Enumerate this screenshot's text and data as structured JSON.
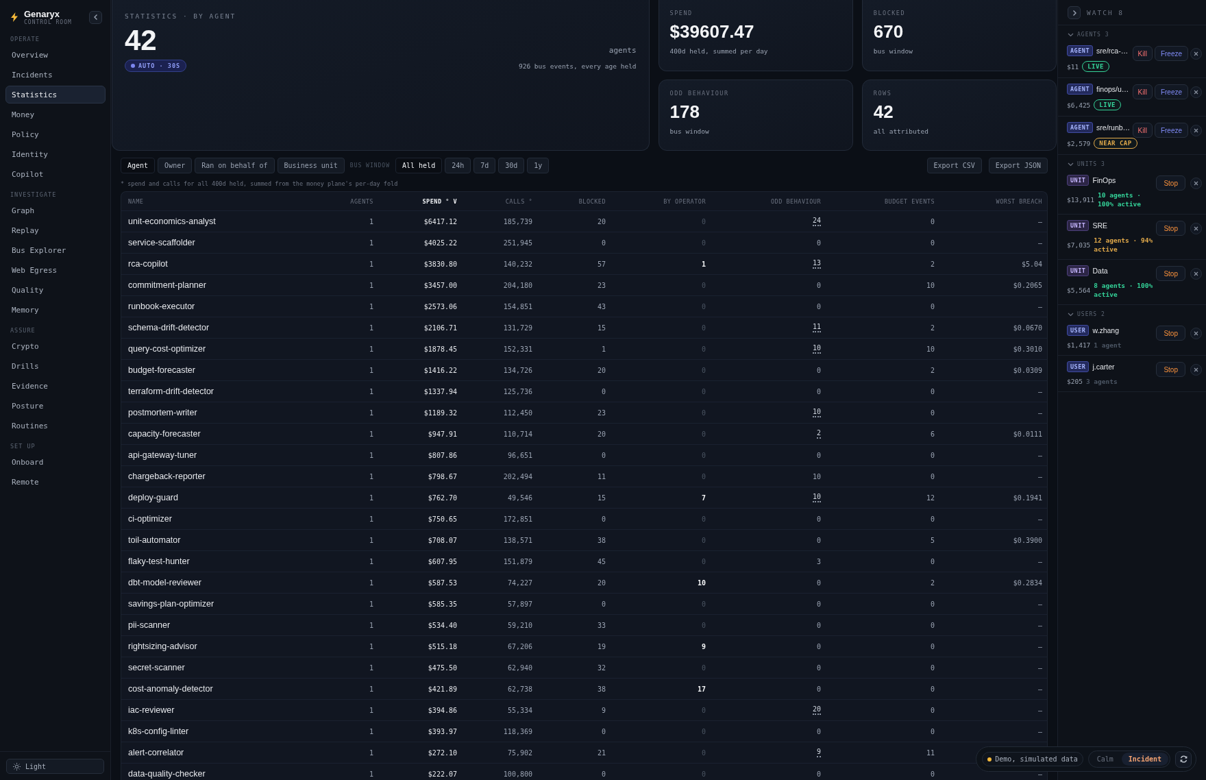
{
  "brand": {
    "name": "Genaryx",
    "subtitle": "CONTROL ROOM"
  },
  "sidebar": {
    "sections": [
      {
        "title": "OPERATE",
        "items": [
          {
            "label": "Overview",
            "selected": false
          },
          {
            "label": "Incidents",
            "selected": false
          },
          {
            "label": "Statistics",
            "selected": true
          },
          {
            "label": "Money",
            "selected": false
          },
          {
            "label": "Policy",
            "selected": false
          },
          {
            "label": "Identity",
            "selected": false
          },
          {
            "label": "Copilot",
            "selected": false
          }
        ]
      },
      {
        "title": "INVESTIGATE",
        "items": [
          {
            "label": "Graph",
            "selected": false
          },
          {
            "label": "Replay",
            "selected": false
          },
          {
            "label": "Bus Explorer",
            "selected": false
          },
          {
            "label": "Web Egress",
            "selected": false
          },
          {
            "label": "Quality",
            "selected": false
          },
          {
            "label": "Memory",
            "selected": false
          }
        ]
      },
      {
        "title": "ASSURE",
        "items": [
          {
            "label": "Crypto",
            "selected": false
          },
          {
            "label": "Drills",
            "selected": false
          },
          {
            "label": "Evidence",
            "selected": false
          },
          {
            "label": "Posture",
            "selected": false
          },
          {
            "label": "Routines",
            "selected": false
          }
        ]
      },
      {
        "title": "SET UP",
        "items": [
          {
            "label": "Onboard",
            "selected": false
          },
          {
            "label": "Remote",
            "selected": false
          }
        ]
      }
    ],
    "theme_button": "Light"
  },
  "hero": {
    "title": "STATISTICS · BY AGENT",
    "value": "42",
    "unit": "agents",
    "badge": "AUTO · 30S",
    "note": "926 bus events, every age held"
  },
  "stats": [
    {
      "label": "SPEND",
      "value": "$39607.47",
      "note": "400d held, summed per day"
    },
    {
      "label": "BLOCKED",
      "value": "670",
      "note": "bus window"
    },
    {
      "label": "ODD BEHAVIOUR",
      "value": "178",
      "note": "bus window"
    },
    {
      "label": "ROWS",
      "value": "42",
      "note": "all attributed"
    }
  ],
  "filters": {
    "group_by": [
      {
        "label": "Agent",
        "selected": true
      },
      {
        "label": "Owner",
        "selected": false
      },
      {
        "label": "Ran on behalf of",
        "selected": false
      },
      {
        "label": "Business unit",
        "selected": false
      }
    ],
    "window_label": "BUS WINDOW",
    "windows": [
      {
        "label": "All held",
        "selected": true
      },
      {
        "label": "24h",
        "selected": false
      },
      {
        "label": "7d",
        "selected": false
      },
      {
        "label": "30d",
        "selected": false
      },
      {
        "label": "1y",
        "selected": false
      }
    ],
    "exports": [
      "Export CSV",
      "Export JSON"
    ]
  },
  "footnote": "* spend and calls for all 400d held, summed from the money plane's per-day fold",
  "table": {
    "columns": [
      {
        "label": "NAME",
        "sorted": false
      },
      {
        "label": "AGENTS",
        "sorted": false
      },
      {
        "label": "SPEND ° V",
        "sorted": true
      },
      {
        "label": "CALLS °",
        "sorted": false
      },
      {
        "label": "BLOCKED",
        "sorted": false
      },
      {
        "label": "BY OPERATOR",
        "sorted": false
      },
      {
        "label": "ODD BEHAVIOUR",
        "sorted": false
      },
      {
        "label": "BUDGET EVENTS",
        "sorted": false
      },
      {
        "label": "WORST BREACH",
        "sorted": false
      }
    ],
    "rows": [
      {
        "name": "unit-economics-analyst",
        "agents": "1",
        "spend": "$6417.12",
        "calls": "185,739",
        "blocked": "20",
        "by_operator": "0",
        "operator_marked": false,
        "odd_behaviour": "24",
        "odd_flagged": true,
        "budget_events": "0",
        "worst_breach": "–"
      },
      {
        "name": "service-scaffolder",
        "agents": "1",
        "spend": "$4025.22",
        "calls": "251,945",
        "blocked": "0",
        "by_operator": "0",
        "operator_marked": false,
        "odd_behaviour": "0",
        "odd_flagged": false,
        "budget_events": "0",
        "worst_breach": "–"
      },
      {
        "name": "rca-copilot",
        "agents": "1",
        "spend": "$3830.80",
        "calls": "140,232",
        "blocked": "57",
        "by_operator": "1",
        "operator_marked": true,
        "odd_behaviour": "13",
        "odd_flagged": true,
        "budget_events": "2",
        "worst_breach": "$5.04"
      },
      {
        "name": "commitment-planner",
        "agents": "1",
        "spend": "$3457.00",
        "calls": "204,180",
        "blocked": "23",
        "by_operator": "0",
        "operator_marked": false,
        "odd_behaviour": "0",
        "odd_flagged": false,
        "budget_events": "10",
        "worst_breach": "$0.2065"
      },
      {
        "name": "runbook-executor",
        "agents": "1",
        "spend": "$2573.06",
        "calls": "154,851",
        "blocked": "43",
        "by_operator": "0",
        "operator_marked": false,
        "odd_behaviour": "0",
        "odd_flagged": false,
        "budget_events": "0",
        "worst_breach": "–"
      },
      {
        "name": "schema-drift-detector",
        "agents": "1",
        "spend": "$2106.71",
        "calls": "131,729",
        "blocked": "15",
        "by_operator": "0",
        "operator_marked": false,
        "odd_behaviour": "11",
        "odd_flagged": true,
        "budget_events": "2",
        "worst_breach": "$0.0670"
      },
      {
        "name": "query-cost-optimizer",
        "agents": "1",
        "spend": "$1878.45",
        "calls": "152,331",
        "blocked": "1",
        "by_operator": "0",
        "operator_marked": false,
        "odd_behaviour": "10",
        "odd_flagged": true,
        "budget_events": "10",
        "worst_breach": "$0.3010"
      },
      {
        "name": "budget-forecaster",
        "agents": "1",
        "spend": "$1416.22",
        "calls": "134,726",
        "blocked": "20",
        "by_operator": "0",
        "operator_marked": false,
        "odd_behaviour": "0",
        "odd_flagged": false,
        "budget_events": "2",
        "worst_breach": "$0.0309"
      },
      {
        "name": "terraform-drift-detector",
        "agents": "1",
        "spend": "$1337.94",
        "calls": "125,736",
        "blocked": "0",
        "by_operator": "0",
        "operator_marked": false,
        "odd_behaviour": "0",
        "odd_flagged": false,
        "budget_events": "0",
        "worst_breach": "–"
      },
      {
        "name": "postmortem-writer",
        "agents": "1",
        "spend": "$1189.32",
        "calls": "112,450",
        "blocked": "23",
        "by_operator": "0",
        "operator_marked": false,
        "odd_behaviour": "10",
        "odd_flagged": true,
        "budget_events": "0",
        "worst_breach": "–"
      },
      {
        "name": "capacity-forecaster",
        "agents": "1",
        "spend": "$947.91",
        "calls": "110,714",
        "blocked": "20",
        "by_operator": "0",
        "operator_marked": false,
        "odd_behaviour": "2",
        "odd_flagged": true,
        "budget_events": "6",
        "worst_breach": "$0.0111"
      },
      {
        "name": "api-gateway-tuner",
        "agents": "1",
        "spend": "$807.86",
        "calls": "96,651",
        "blocked": "0",
        "by_operator": "0",
        "operator_marked": false,
        "odd_behaviour": "0",
        "odd_flagged": false,
        "budget_events": "0",
        "worst_breach": "–"
      },
      {
        "name": "chargeback-reporter",
        "agents": "1",
        "spend": "$798.67",
        "calls": "202,494",
        "blocked": "11",
        "by_operator": "0",
        "operator_marked": false,
        "odd_behaviour": "10",
        "odd_flagged": false,
        "budget_events": "0",
        "worst_breach": "–"
      },
      {
        "name": "deploy-guard",
        "agents": "1",
        "spend": "$762.70",
        "calls": "49,546",
        "blocked": "15",
        "by_operator": "7",
        "operator_marked": true,
        "odd_behaviour": "10",
        "odd_flagged": true,
        "budget_events": "12",
        "worst_breach": "$0.1941"
      },
      {
        "name": "ci-optimizer",
        "agents": "1",
        "spend": "$750.65",
        "calls": "172,851",
        "blocked": "0",
        "by_operator": "0",
        "operator_marked": false,
        "odd_behaviour": "0",
        "odd_flagged": false,
        "budget_events": "0",
        "worst_breach": "–"
      },
      {
        "name": "toil-automator",
        "agents": "1",
        "spend": "$708.07",
        "calls": "138,571",
        "blocked": "38",
        "by_operator": "0",
        "operator_marked": false,
        "odd_behaviour": "0",
        "odd_flagged": false,
        "budget_events": "5",
        "worst_breach": "$0.3900"
      },
      {
        "name": "flaky-test-hunter",
        "agents": "1",
        "spend": "$607.95",
        "calls": "151,879",
        "blocked": "45",
        "by_operator": "0",
        "operator_marked": false,
        "odd_behaviour": "3",
        "odd_flagged": false,
        "budget_events": "0",
        "worst_breach": "–"
      },
      {
        "name": "dbt-model-reviewer",
        "agents": "1",
        "spend": "$587.53",
        "calls": "74,227",
        "blocked": "20",
        "by_operator": "10",
        "operator_marked": true,
        "odd_behaviour": "0",
        "odd_flagged": false,
        "budget_events": "2",
        "worst_breach": "$0.2834"
      },
      {
        "name": "savings-plan-optimizer",
        "agents": "1",
        "spend": "$585.35",
        "calls": "57,897",
        "blocked": "0",
        "by_operator": "0",
        "operator_marked": false,
        "odd_behaviour": "0",
        "odd_flagged": false,
        "budget_events": "0",
        "worst_breach": "–"
      },
      {
        "name": "pii-scanner",
        "agents": "1",
        "spend": "$534.40",
        "calls": "59,210",
        "blocked": "33",
        "by_operator": "0",
        "operator_marked": false,
        "odd_behaviour": "0",
        "odd_flagged": false,
        "budget_events": "0",
        "worst_breach": "–"
      },
      {
        "name": "rightsizing-advisor",
        "agents": "1",
        "spend": "$515.18",
        "calls": "67,206",
        "blocked": "19",
        "by_operator": "9",
        "operator_marked": true,
        "odd_behaviour": "0",
        "odd_flagged": false,
        "budget_events": "0",
        "worst_breach": "–"
      },
      {
        "name": "secret-scanner",
        "agents": "1",
        "spend": "$475.50",
        "calls": "62,940",
        "blocked": "32",
        "by_operator": "0",
        "operator_marked": false,
        "odd_behaviour": "0",
        "odd_flagged": false,
        "budget_events": "0",
        "worst_breach": "–"
      },
      {
        "name": "cost-anomaly-detector",
        "agents": "1",
        "spend": "$421.89",
        "calls": "62,738",
        "blocked": "38",
        "by_operator": "17",
        "operator_marked": true,
        "odd_behaviour": "0",
        "odd_flagged": false,
        "budget_events": "0",
        "worst_breach": "–"
      },
      {
        "name": "iac-reviewer",
        "agents": "1",
        "spend": "$394.86",
        "calls": "55,334",
        "blocked": "9",
        "by_operator": "0",
        "operator_marked": false,
        "odd_behaviour": "20",
        "odd_flagged": true,
        "budget_events": "0",
        "worst_breach": "–"
      },
      {
        "name": "k8s-config-linter",
        "agents": "1",
        "spend": "$393.97",
        "calls": "118,369",
        "blocked": "0",
        "by_operator": "0",
        "operator_marked": false,
        "odd_behaviour": "0",
        "odd_flagged": false,
        "budget_events": "0",
        "worst_breach": "–"
      },
      {
        "name": "alert-correlator",
        "agents": "1",
        "spend": "$272.10",
        "calls": "75,902",
        "blocked": "21",
        "by_operator": "0",
        "operator_marked": false,
        "odd_behaviour": "9",
        "odd_flagged": true,
        "budget_events": "11"
      },
      {
        "name": "data-quality-checker",
        "agents": "1",
        "spend": "$222.07",
        "calls": "100,800",
        "blocked": "0",
        "by_operator": "0",
        "operator_marked": false,
        "odd_behaviour": "0",
        "odd_flagged": false,
        "budget_events": "0",
        "worst_breach": "–"
      }
    ]
  },
  "watch": {
    "title": "WATCH 8",
    "sections": [
      {
        "title": "AGENTS 3",
        "expanded": true,
        "items": [
          {
            "kind": "agent",
            "tag": "AGENT",
            "name": "sre/rca-…",
            "amount": "$11",
            "status": "LIVE",
            "color": "#34d399",
            "actions": [
              {
                "kind": "kill",
                "label": "Kill"
              },
              {
                "kind": "freeze",
                "label": "Freeze"
              }
            ]
          },
          {
            "kind": "agent",
            "tag": "AGENT",
            "name": "finops/u…",
            "amount": "$6,425",
            "status": "LIVE",
            "color": "#34d399",
            "actions": [
              {
                "kind": "kill",
                "label": "Kill"
              },
              {
                "kind": "freeze",
                "label": "Freeze"
              }
            ]
          },
          {
            "kind": "agent",
            "tag": "AGENT",
            "name": "sre/runb…",
            "amount": "$2,579",
            "status": "NEAR CAP",
            "color": "#e0a84a",
            "actions": [
              {
                "kind": "kill",
                "label": "Kill"
              },
              {
                "kind": "freeze",
                "label": "Freeze"
              }
            ]
          }
        ]
      },
      {
        "title": "UNITS 3",
        "expanded": true,
        "items": [
          {
            "kind": "unit",
            "tag": "UNIT",
            "name": "FinOps",
            "amount": "$13,911",
            "note": "10 agents · 100% active",
            "color": "#34d399",
            "actions": [
              {
                "kind": "stop",
                "label": "Stop"
              }
            ]
          },
          {
            "kind": "unit",
            "tag": "UNIT",
            "name": "SRE",
            "amount": "$7,035",
            "note": "12 agents · 94% active",
            "color": "#e0a84a",
            "actions": [
              {
                "kind": "stop",
                "label": "Stop"
              }
            ]
          },
          {
            "kind": "unit",
            "tag": "UNIT",
            "name": "Data",
            "amount": "$5,564",
            "note": "8 agents · 100% active",
            "color": "#34d399",
            "actions": [
              {
                "kind": "stop",
                "label": "Stop"
              }
            ]
          }
        ]
      },
      {
        "title": "USERS 2",
        "expanded": true,
        "items": [
          {
            "kind": "user",
            "tag": "USER",
            "name": "w.zhang",
            "amount": "$1,417",
            "note": "1 agent",
            "actions": [
              {
                "kind": "stop",
                "label": "Stop"
              }
            ]
          },
          {
            "kind": "user",
            "tag": "USER",
            "name": "j.carter",
            "amount": "$205",
            "note": "3 agents",
            "actions": [
              {
                "kind": "stop",
                "label": "Stop"
              }
            ]
          }
        ]
      }
    ]
  },
  "demo_bar": {
    "label": "Demo, simulated data",
    "modes": [
      {
        "label": "Calm",
        "selected": false
      },
      {
        "label": "Incident",
        "selected": true
      }
    ]
  }
}
